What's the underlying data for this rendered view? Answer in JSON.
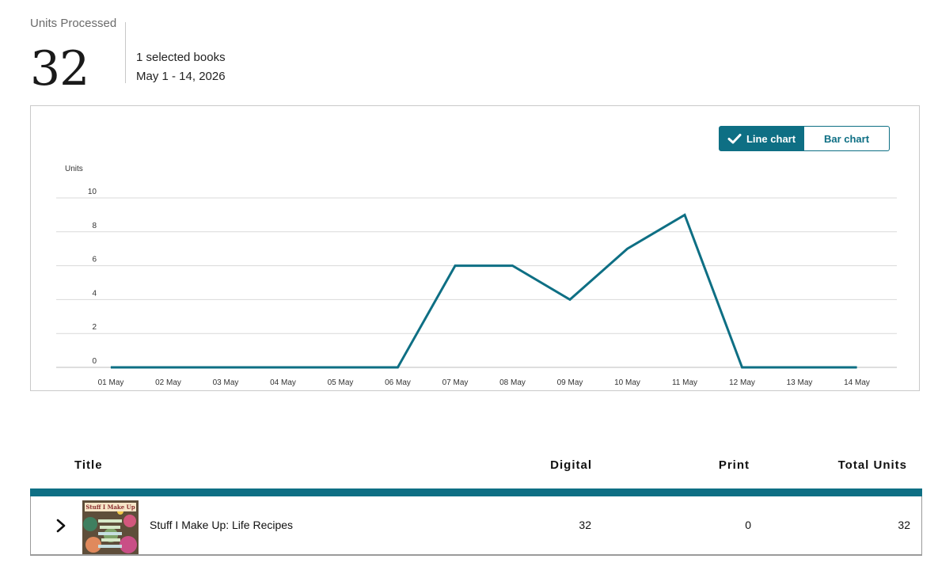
{
  "summary": {
    "label": "Units Processed",
    "value": "32",
    "books": "1 selected books",
    "date_range": "May 1 - 14, 2026"
  },
  "chart_toggle": {
    "line_label": "Line chart",
    "bar_label": "Bar chart",
    "selected": "line"
  },
  "chart_data": {
    "type": "line",
    "ylabel": "Units",
    "ylim": [
      0,
      10
    ],
    "yticks": [
      0,
      2,
      4,
      6,
      8,
      10
    ],
    "grid": true,
    "categories": [
      "01 May",
      "02 May",
      "03 May",
      "04 May",
      "05 May",
      "06 May",
      "07 May",
      "08 May",
      "09 May",
      "10 May",
      "11 May",
      "12 May",
      "13 May",
      "14 May"
    ],
    "series": [
      {
        "values": [
          0,
          0,
          0,
          0,
          0,
          0,
          6,
          6,
          4,
          7,
          9,
          0,
          0,
          0
        ]
      }
    ],
    "line_color": "#0e6f84"
  },
  "table": {
    "headers": {
      "title": "Title",
      "digital": "Digital",
      "print": "Print",
      "total": "Total Units"
    },
    "rows": [
      {
        "cover_text": "Stuff I Make Up",
        "title": "Stuff I Make Up: Life Recipes",
        "digital": "32",
        "print": "0",
        "total": "32"
      }
    ]
  },
  "colors": {
    "accent": "#0e6f84",
    "gridline": "#d9d9d9"
  }
}
